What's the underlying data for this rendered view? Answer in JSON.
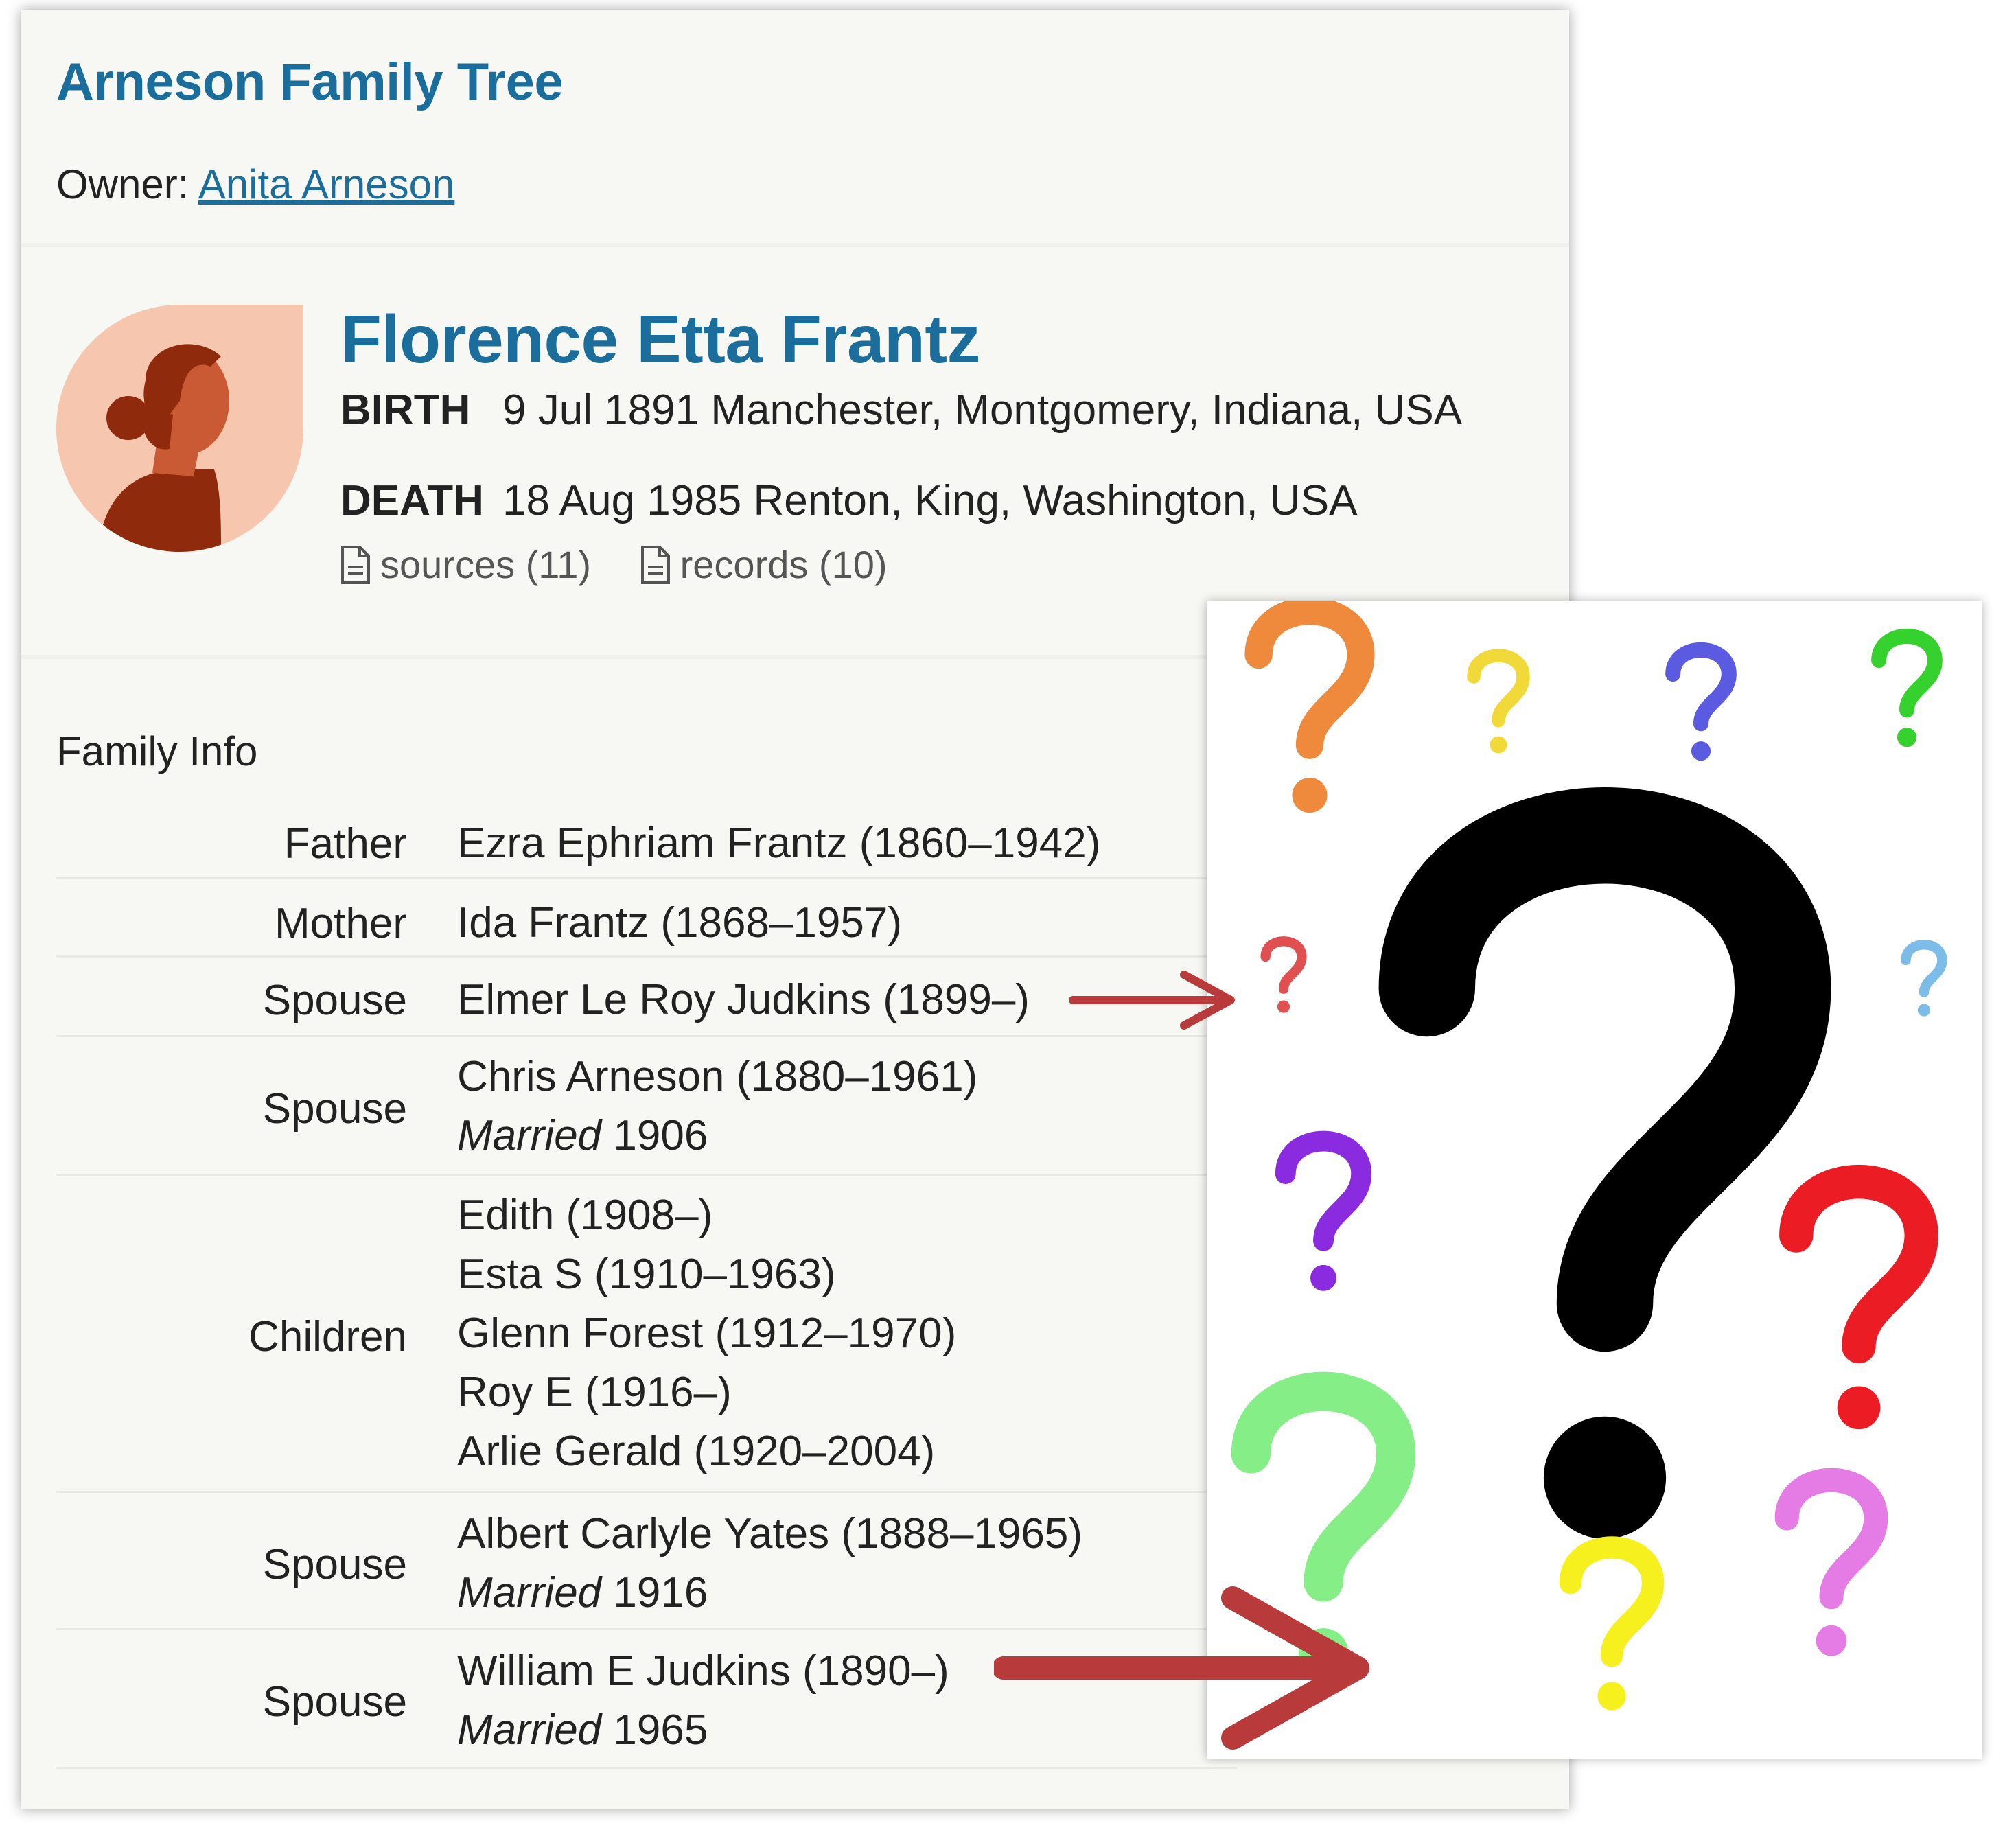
{
  "tree": {
    "title": "Arneson Family Tree",
    "owner_label": "Owner:",
    "owner_name": "Anita Arneson"
  },
  "person": {
    "name": "Florence Etta Frantz",
    "birth_label": "BIRTH",
    "birth_value": "9 Jul 1891 Manchester, Montgomery, Indiana, USA",
    "death_label": "DEATH",
    "death_value": "18 Aug 1985 Renton, King, Washington, USA",
    "sources_link": "sources (11)",
    "records_link": "records (10)"
  },
  "family": {
    "section_title": "Family Info",
    "father_label": "Father",
    "father": "Ezra Ephriam Frantz (1860–1942)",
    "mother_label": "Mother",
    "mother": "Ida Frantz (1868–1957)",
    "spouse_label": "Spouse",
    "spouse1": "Elmer Le Roy Judkins (1899–)",
    "spouse2": "Chris Arneson (1880–1961)",
    "spouse2_married_word": "Married",
    "spouse2_married_year": "1906",
    "children_label": "Children",
    "children": [
      "Edith (1908–)",
      "Esta S (1910–1963)",
      "Glenn Forest (1912–1970)",
      "Roy E (1916–)",
      "Arlie Gerald (1920–2004)"
    ],
    "spouse3": "Albert Carlyle Yates (1888–1965)",
    "spouse3_married_word": "Married",
    "spouse3_married_year": "1916",
    "spouse4": "William E Judkins (1890–)",
    "spouse4_married_word": "Married",
    "spouse4_married_year": "1965"
  },
  "colors": {
    "link_blue": "#1b6e9b",
    "arrow_red": "#b83a3a",
    "avatar_bg": "#f6c6ae",
    "avatar_hair": "#8f2a0c"
  },
  "icons": {
    "document": "document-icon",
    "avatar": "female-avatar-icon",
    "question": "question-mark-icon"
  }
}
